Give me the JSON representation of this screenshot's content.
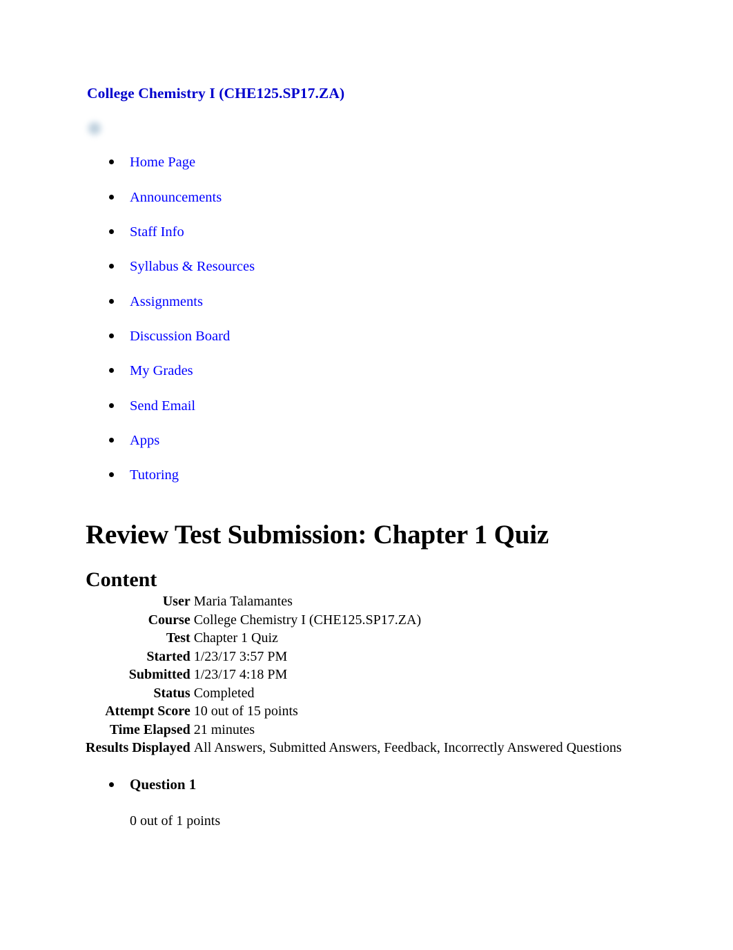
{
  "course": {
    "title": "College Chemistry I (CHE125.SP17.ZA)"
  },
  "nav": {
    "items": [
      {
        "label": "Home Page"
      },
      {
        "label": "Announcements"
      },
      {
        "label": "Staff Info"
      },
      {
        "label": "Syllabus & Resources"
      },
      {
        "label": "Assignments"
      },
      {
        "label": "Discussion Board"
      },
      {
        "label": "My Grades"
      },
      {
        "label": "Send Email"
      },
      {
        "label": "Apps"
      },
      {
        "label": "Tutoring"
      }
    ]
  },
  "page_title": "Review Test Submission: Chapter 1 Quiz",
  "section_title": "Content",
  "info": {
    "rows": [
      {
        "label": "User",
        "value": "Maria Talamantes"
      },
      {
        "label": "Course",
        "value": "College Chemistry I (CHE125.SP17.ZA)"
      },
      {
        "label": "Test",
        "value": "Chapter 1 Quiz"
      },
      {
        "label": "Started",
        "value": "1/23/17 3:57 PM"
      },
      {
        "label": "Submitted",
        "value": "1/23/17 4:18 PM"
      },
      {
        "label": "Status",
        "value": "Completed"
      },
      {
        "label": "Attempt Score",
        "value": "10 out of 15 points"
      },
      {
        "label": "Time Elapsed",
        "value": "21 minutes"
      },
      {
        "label": "Results Displayed",
        "value": "All Answers, Submitted Answers, Feedback, Incorrectly Answered Questions"
      }
    ]
  },
  "question": {
    "label": "Question 1",
    "points": "0 out of 1 points"
  },
  "colors": {
    "course_title": "#0000CC",
    "link": "#0000FF",
    "text": "#000000",
    "background": "#ffffff"
  }
}
